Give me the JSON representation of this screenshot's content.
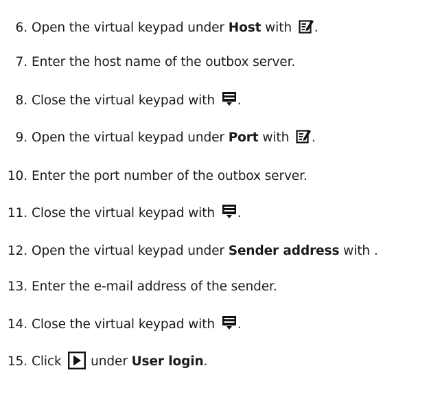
{
  "steps": [
    {
      "number": "6.",
      "before": "Open the virtual keypad under ",
      "bold": "Host",
      "after": " with ",
      "icon": "edit-keypad-icon",
      "end": "."
    },
    {
      "number": "7.",
      "text": "Enter the host name of the outbox server."
    },
    {
      "number": "8.",
      "before": "Close the virtual keypad with ",
      "icon": "close-keypad-icon",
      "end": "."
    },
    {
      "number": "9.",
      "before": "Open the virtual keypad under ",
      "bold": "Port",
      "after": " with ",
      "icon": "edit-keypad-icon",
      "end": "."
    },
    {
      "number": "10.",
      "text": "Enter the port number of the outbox server."
    },
    {
      "number": "11.",
      "before": "Close the virtual keypad with ",
      "icon": "close-keypad-icon",
      "end": "."
    },
    {
      "number": "12.",
      "before": "Open the virtual keypad under ",
      "bold": "Sender address",
      "after": " with ",
      "end": "."
    },
    {
      "number": "13.",
      "text": "Enter the e-mail address of the sender."
    },
    {
      "number": "14.",
      "before": "Close the virtual keypad with ",
      "icon": "close-keypad-icon",
      "end": "."
    },
    {
      "number": "15.",
      "before": "Click ",
      "icon": "play-icon",
      "after": " under ",
      "bold": "User login",
      "end": "."
    }
  ]
}
